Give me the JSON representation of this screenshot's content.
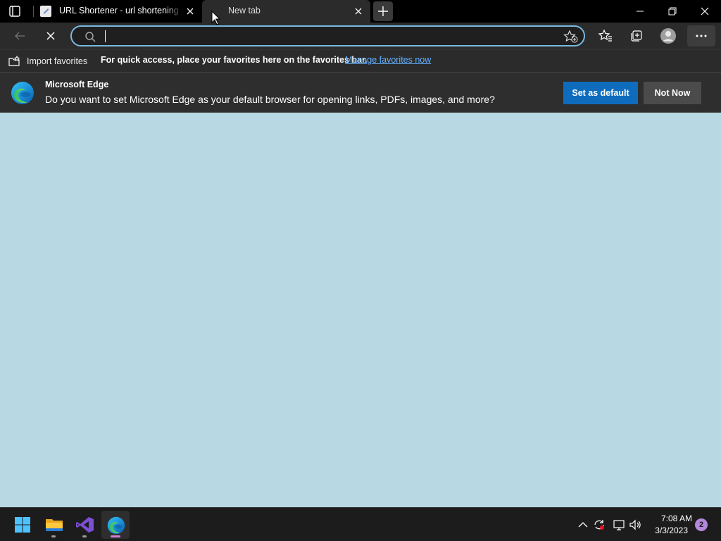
{
  "tabs": [
    {
      "title": "URL Shortener - url shortening se",
      "active": false
    },
    {
      "title": "New tab",
      "active": true
    }
  ],
  "address_bar": {
    "value": "",
    "placeholder": ""
  },
  "favorites_bar": {
    "import_label": "Import favorites",
    "message": "For quick access, place your favorites here on the favorites bar.",
    "manage_link": "Manage favorites now"
  },
  "infobar": {
    "title": "Microsoft Edge",
    "text": "Do you want to set Microsoft Edge as your default browser for opening links, PDFs, images, and more?",
    "primary_button": "Set as default",
    "secondary_button": "Not Now"
  },
  "taskbar": {
    "apps": [
      "windows-start-icon",
      "file-explorer-icon",
      "visual-studio-icon",
      "edge-icon"
    ],
    "time": "7:08 AM",
    "date": "3/3/2023",
    "notification_count": "2"
  },
  "colors": {
    "content_bg": "#b8d8e4",
    "accent": "#0f6cbd",
    "link": "#62b0ff",
    "address_focus": "#79b8e0"
  }
}
